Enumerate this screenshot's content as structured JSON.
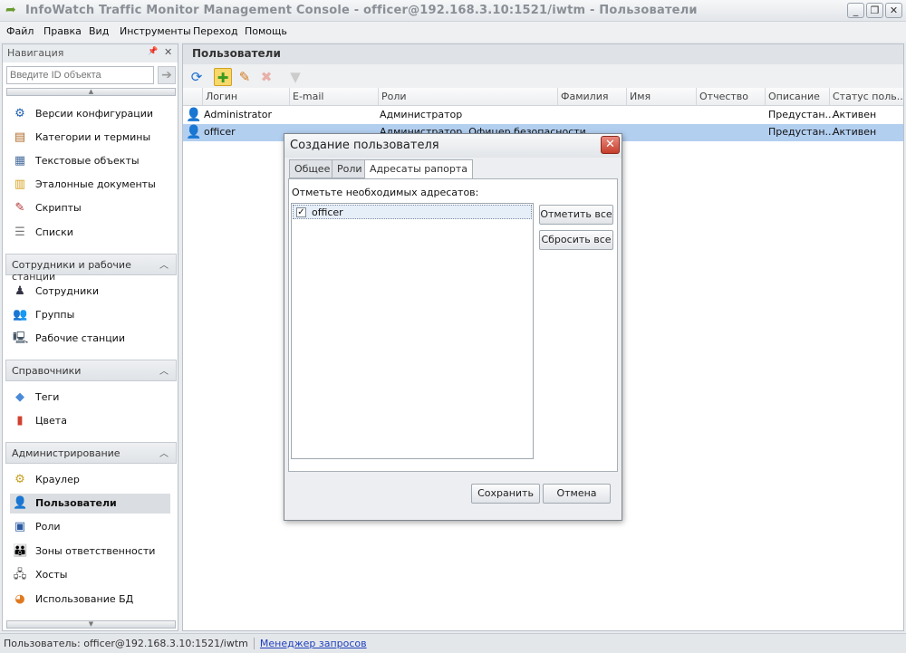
{
  "window": {
    "title": "InfoWatch Traffic Monitor Management Console - officer@192.168.3.10:1521/iwtm - Пользователи",
    "minimize": "_",
    "maximize": "❐",
    "close": "✕"
  },
  "menu": [
    "Файл",
    "Правка",
    "Вид",
    "Инструменты",
    "Переход",
    "Помощь"
  ],
  "nav": {
    "title": "Навигация",
    "pin": "📌",
    "close": "✕",
    "search_placeholder": "Введите ID объекта",
    "go": "➔",
    "items_top": [
      "Версии конфигурации",
      "Категории и термины",
      "Текстовые объекты",
      "Эталонные документы",
      "Скрипты",
      "Списки"
    ],
    "sections": [
      {
        "title": "Сотрудники и рабочие станции",
        "items": [
          "Сотрудники",
          "Группы",
          "Рабочие станции"
        ]
      },
      {
        "title": "Справочники",
        "items": [
          "Теги",
          "Цвета"
        ]
      },
      {
        "title": "Администрирование",
        "items": [
          "Краулер",
          "Пользователи",
          "Роли",
          "Зоны ответственности",
          "Хосты",
          "Использование БД"
        ]
      }
    ],
    "selected": "Пользователи"
  },
  "main": {
    "title": "Пользователи",
    "columns": [
      "Логин",
      "E-mail",
      "Роли",
      "Фамилия",
      "Имя",
      "Отчество",
      "Описание",
      "Статус поль..."
    ],
    "rows": [
      {
        "login": "Administrator",
        "email": "",
        "roles": "Администратор",
        "last": "",
        "first": "",
        "middle": "",
        "desc": "Предустан...",
        "status": "Активен"
      },
      {
        "login": "officer",
        "email": "",
        "roles": "Администратор, Офицер безопасности",
        "last": "",
        "first": "",
        "middle": "",
        "desc": "Предустан...",
        "status": "Активен"
      }
    ]
  },
  "dialog": {
    "title": "Создание пользователя",
    "close": "✕",
    "tabs": [
      "Общее",
      "Роли",
      "Адресаты рапорта"
    ],
    "active_tab": "Адресаты рапорта",
    "label": "Отметьте необходимых адресатов:",
    "recipients": [
      {
        "name": "officer",
        "checked": true,
        "mark": "✓"
      }
    ],
    "check_all": "Отметить все",
    "reset_all": "Сбросить все",
    "save": "Сохранить",
    "cancel": "Отмена"
  },
  "status": {
    "user": "Пользователь: officer@192.168.3.10:1521/iwtm",
    "link": "Менеджер запросов"
  }
}
